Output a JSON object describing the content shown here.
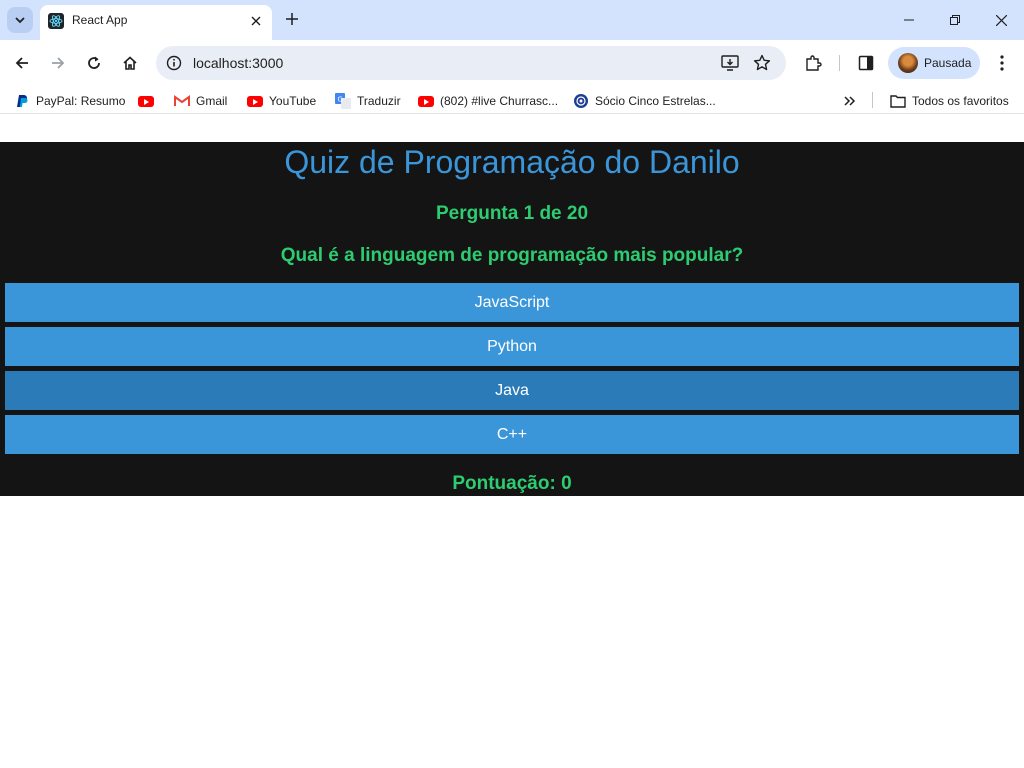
{
  "browser": {
    "tab_title": "React App",
    "url": "localhost:3000",
    "profile_label": "Pausada"
  },
  "bookmarks": {
    "items": [
      {
        "label": "PayPal: Resumo"
      },
      {
        "label": ""
      },
      {
        "label": "Gmail"
      },
      {
        "label": "YouTube"
      },
      {
        "label": "Traduzir"
      },
      {
        "label": "(802) #live Churrasc..."
      },
      {
        "label": "Sócio Cinco Estrelas..."
      }
    ],
    "all_bookmarks_label": "Todos os favoritos"
  },
  "quiz": {
    "title": "Quiz de Programação do Danilo",
    "question_counter": "Pergunta 1 de 20",
    "question": "Qual é a linguagem de programação mais popular?",
    "answers": [
      {
        "label": "JavaScript"
      },
      {
        "label": "Python"
      },
      {
        "label": "Java"
      },
      {
        "label": "C++"
      }
    ],
    "score_text": "Pontuação: 0"
  },
  "colors": {
    "title_blue": "#3b96d9",
    "accent_green": "#2ecc71",
    "app_background": "#141414",
    "answer_button": "#3b96d9",
    "answer_button_hover": "#2b7bb8"
  }
}
